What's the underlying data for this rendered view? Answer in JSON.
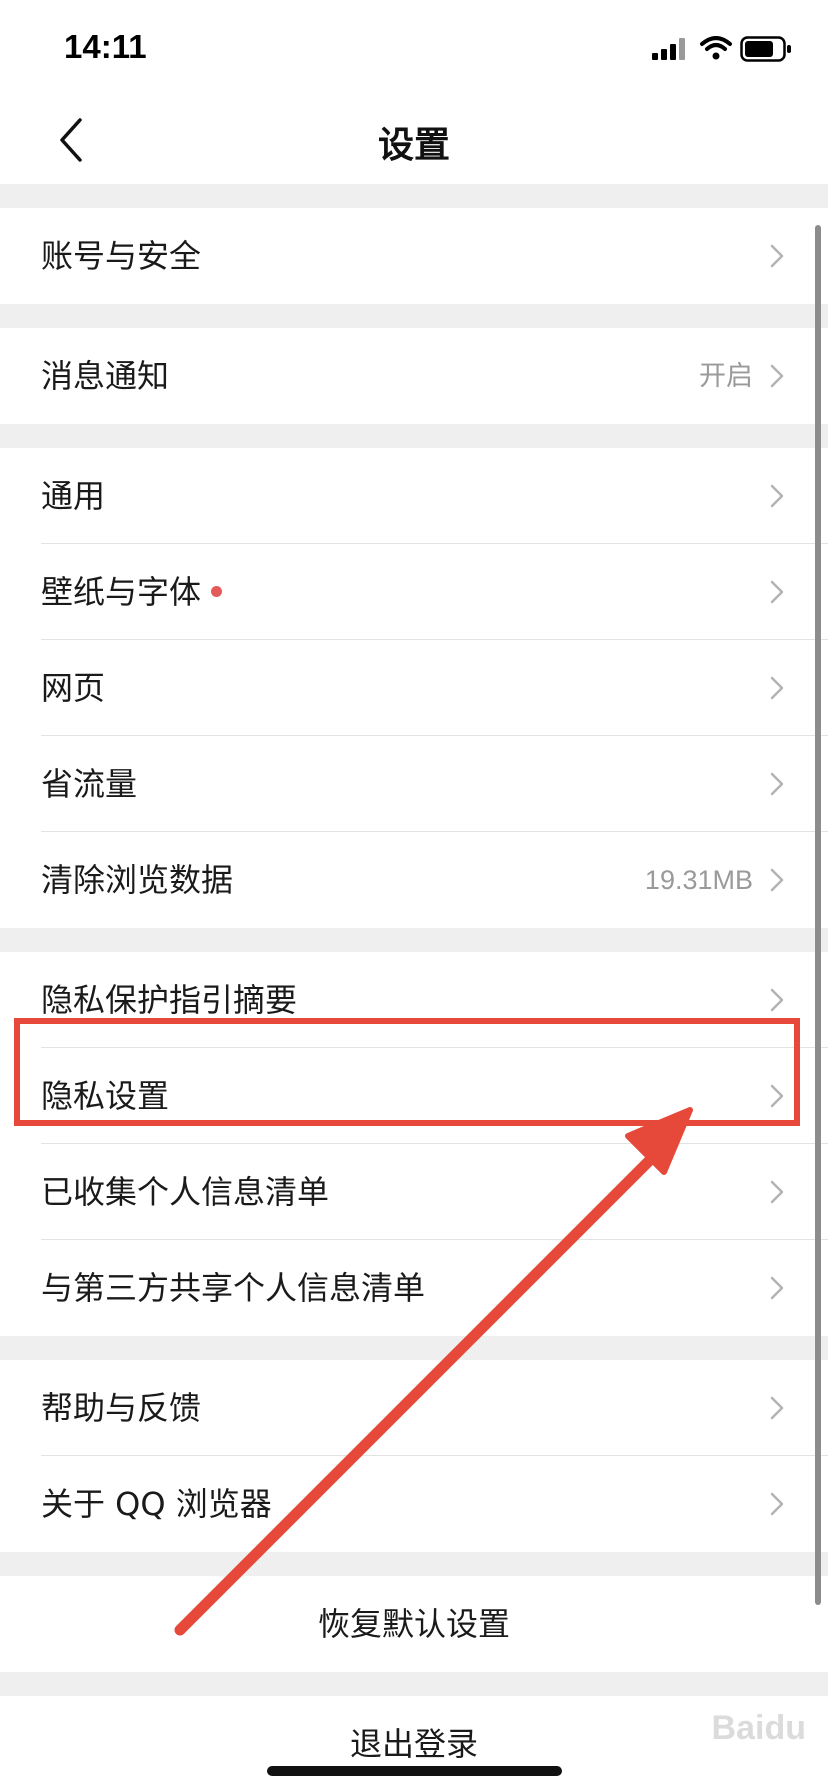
{
  "status_bar": {
    "time": "14:11"
  },
  "header": {
    "title": "设置"
  },
  "groups": {
    "g1": [
      {
        "label": "账号与安全"
      }
    ],
    "g2": [
      {
        "label": "消息通知",
        "value": "开启"
      }
    ],
    "g3": [
      {
        "label": "通用"
      },
      {
        "label": "壁纸与字体"
      },
      {
        "label": "网页"
      },
      {
        "label": "省流量"
      },
      {
        "label": "清除浏览数据",
        "value": "19.31MB"
      }
    ],
    "g4": [
      {
        "label": "隐私保护指引摘要"
      },
      {
        "label": "隐私设置"
      },
      {
        "label": "已收集个人信息清单"
      },
      {
        "label": "与第三方共享个人信息清单"
      }
    ],
    "g5": [
      {
        "label": "帮助与反馈"
      },
      {
        "label": "关于 QQ 浏览器"
      }
    ]
  },
  "actions": {
    "restore_label": "恢复默认设置",
    "logout_label": "退出登录"
  },
  "annotation": {
    "color": "#e6493a",
    "highlighted_item": "隐私设置"
  },
  "colors": {
    "badge_dot": "#e45a5a",
    "secondary_text": "#9a9a9a"
  }
}
